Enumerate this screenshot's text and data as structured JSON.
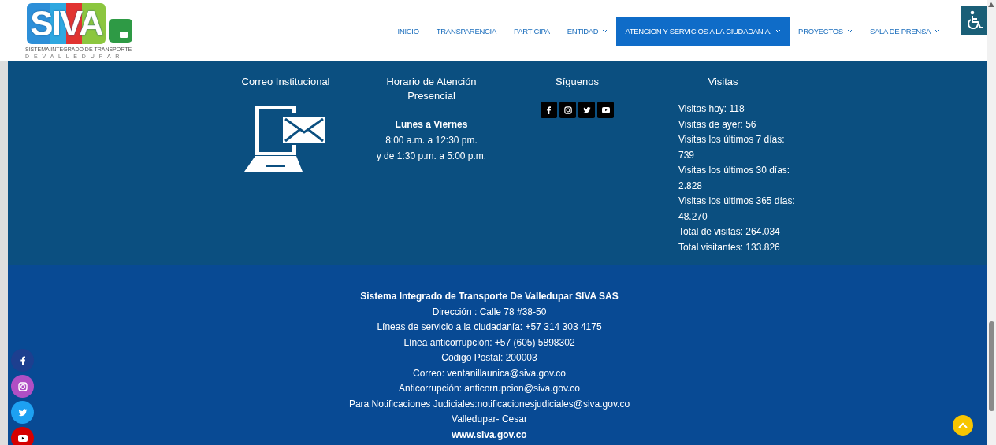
{
  "logo": {
    "wordmark": "SIVA",
    "subtitle": "SISTEMA INTEGRADO DE TRANSPORTE",
    "city": "D E V A L L E D U P A R"
  },
  "nav": [
    {
      "label": "INICIO",
      "has_menu": false,
      "selected": false
    },
    {
      "label": "TRANSPARENCIA",
      "has_menu": false,
      "selected": false
    },
    {
      "label": "PARTICIPA",
      "has_menu": false,
      "selected": false
    },
    {
      "label": "ENTIDAD",
      "has_menu": true,
      "selected": false
    },
    {
      "label": "ATENCIÓN Y SERVICIOS A LA CIUDADANÍA.",
      "has_menu": true,
      "selected": true
    },
    {
      "label": "PROYECTOS",
      "has_menu": true,
      "selected": false
    },
    {
      "label": "SALA DE PRENSA",
      "has_menu": true,
      "selected": false
    }
  ],
  "info": {
    "mail": {
      "title": "Correo Institucional"
    },
    "hours": {
      "title": "Horario de Atención Presencial",
      "days": "Lunes a Viernes",
      "lines": [
        "8:00 a.m. a 12:30 pm.",
        "y de 1:30 p.m. a 5:00 p.m."
      ]
    },
    "follow": {
      "title": "Síguenos",
      "networks": [
        {
          "kind": "facebook"
        },
        {
          "kind": "instagram"
        },
        {
          "kind": "twitter"
        },
        {
          "kind": "youtube"
        }
      ]
    },
    "visits": {
      "title": "Visitas",
      "lines": [
        "Visitas hoy: 118",
        "Visitas de ayer: 56",
        "Visitas los últimos 7 días:",
        "739",
        "Visitas los últimos 30 días:",
        "2.828",
        "Visitas los últimos 365 días:",
        "48.270",
        "Total de visitas: 264.034",
        "Total visitantes: 133.826"
      ]
    }
  },
  "footer": [
    {
      "text": "Sistema Integrado de Transporte De Valledupar SIVA SAS",
      "bold": true
    },
    {
      "text": "Dirección : Calle 78 #38-50",
      "bold": false
    },
    {
      "text": "Líneas de servicio a la ciudadanía: +57 314 303 4175",
      "bold": false
    },
    {
      "text": "Línea anticorrupción: +57 (605) 5898302",
      "bold": false
    },
    {
      "text": "Codigo Postal: 200003",
      "bold": false
    },
    {
      "text": "Correo: ventanillaunica@siva.gov.co",
      "bold": false
    },
    {
      "text": "Anticorrupción: anticorrupcion@siva.gov.co",
      "bold": false
    },
    {
      "text": "Para Notificaciones Judiciales:notificacionesjudiciales@siva.gov.co",
      "bold": false
    },
    {
      "text": "Valledupar- Cesar",
      "bold": false
    },
    {
      "text": "www.siva.gov.co",
      "bold": true
    }
  ],
  "floating_social": [
    {
      "kind": "facebook",
      "color": "#1d3f8f"
    },
    {
      "kind": "instagram",
      "color": "#b04fc4"
    },
    {
      "kind": "twitter",
      "color": "#1da1f2"
    },
    {
      "kind": "youtube",
      "color": "#d50000"
    }
  ]
}
